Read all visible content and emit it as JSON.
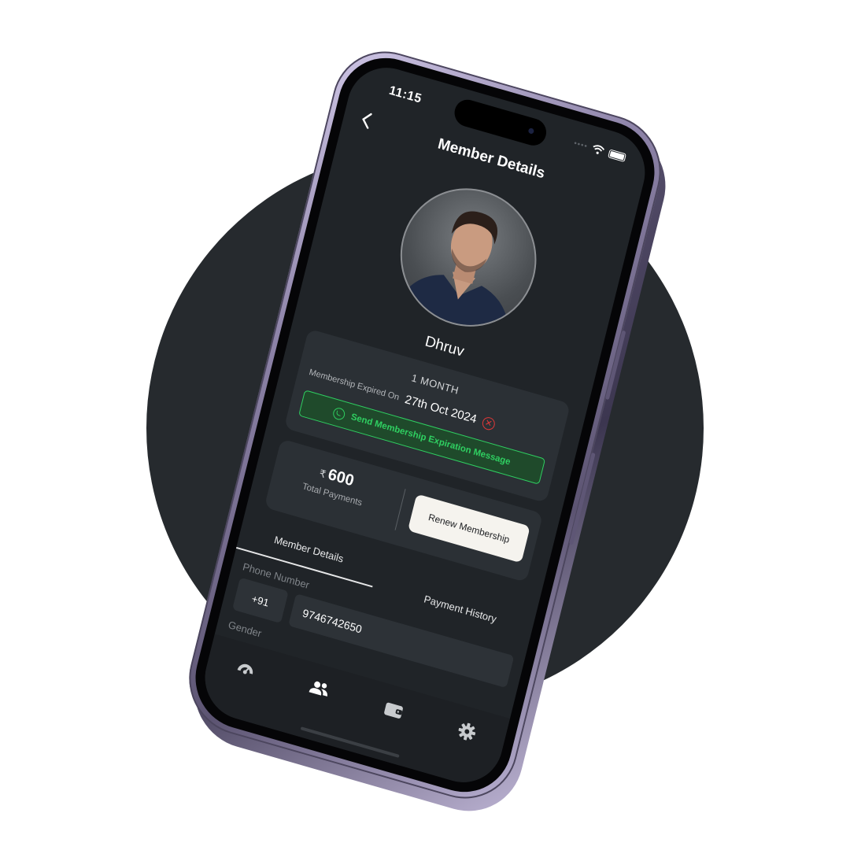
{
  "status_bar": {
    "time": "11:15",
    "dots": "••••"
  },
  "header": {
    "title": "Member Details",
    "back_label": "<"
  },
  "member": {
    "name": "Dhruv"
  },
  "membership": {
    "plan": "1 MONTH",
    "expiry_label": "Membership Expired On",
    "expiry_date": "27th Oct 2024",
    "send_message_label": "Send Membership Expiration Message"
  },
  "payments": {
    "currency": "₹",
    "amount": "600",
    "label": "Total Payments",
    "renew_label": "Renew Membership"
  },
  "tabs": [
    {
      "label": "Member Details",
      "active": true
    },
    {
      "label": "Payment History",
      "active": false
    }
  ],
  "form": {
    "phone_label": "Phone Number",
    "country_code": "+91",
    "phone_number": "9746742650",
    "gender_label": "Gender"
  },
  "bottom_nav": [
    {
      "icon": "dashboard-icon",
      "active": false
    },
    {
      "icon": "members-icon",
      "active": true
    },
    {
      "icon": "wallet-icon",
      "active": false
    },
    {
      "icon": "settings-icon",
      "active": false
    }
  ],
  "colors": {
    "background_circle": "#262a2e",
    "screen_bg": "#202428",
    "card_bg": "#2b3035",
    "whatsapp_green": "#2fcf61",
    "error_red": "#e23838",
    "phone_frame": "#8d83a8"
  }
}
